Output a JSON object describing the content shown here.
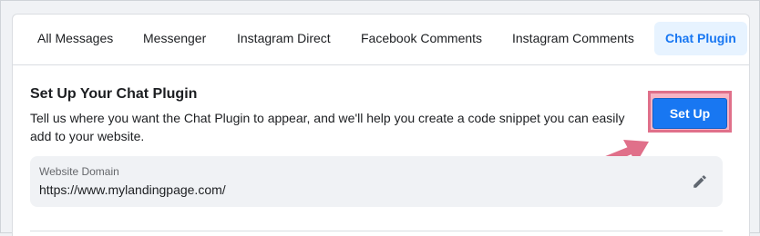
{
  "tabs": [
    {
      "label": "All Messages",
      "active": false
    },
    {
      "label": "Messenger",
      "active": false
    },
    {
      "label": "Instagram Direct",
      "active": false
    },
    {
      "label": "Facebook Comments",
      "active": false
    },
    {
      "label": "Instagram Comments",
      "active": false
    },
    {
      "label": "Chat Plugin",
      "active": true
    }
  ],
  "section": {
    "title": "Set Up Your Chat Plugin",
    "description": "Tell us where you want the Chat Plugin to appear, and we'll help you create a code snippet you can easily add to your website.",
    "setup_button": "Set Up"
  },
  "domain": {
    "label": "Website Domain",
    "value": "https://www.mylandingpage.com/"
  },
  "icons": {
    "edit": "pencil-icon",
    "annotation": "pink-arrow-icon"
  },
  "colors": {
    "accent": "#1877f2",
    "highlight": "#e0708a",
    "tab_active_bg": "#e7f3ff"
  }
}
